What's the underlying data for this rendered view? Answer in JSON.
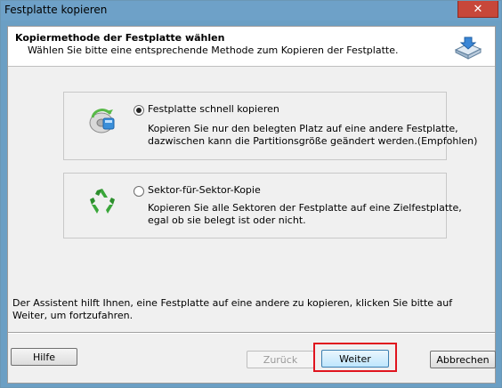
{
  "window": {
    "title": "Festplatte kopieren",
    "close_glyph": "✕"
  },
  "header": {
    "title": "Kopiermethode der Festplatte wählen",
    "subtitle": "Wählen Sie bitte eine entsprechende Methode zum Kopieren der Festplatte.",
    "icon": "disk-copy-icon"
  },
  "options": [
    {
      "label": "Festplatte schnell kopieren",
      "selected": true,
      "description_line1": "Kopieren Sie nur den belegten Platz auf eine andere Festplatte,",
      "description_line2": "dazwischen kann die Partitionsgröße geändert werden.(Empfohlen)",
      "icon": "fast-copy-disk-icon"
    },
    {
      "label": "Sektor-für-Sektor-Kopie",
      "selected": false,
      "description_line1": "Kopieren Sie alle Sektoren der Festplatte auf eine Zielfestplatte,",
      "description_line2": "egal ob sie belegt ist oder nicht.",
      "icon": "recycle-icon"
    }
  ],
  "hint": "Der Assistent hilft Ihnen, eine Festplatte auf eine andere zu kopieren, klicken Sie bitte auf Weiter, um fortzufahren.",
  "buttons": {
    "help": "Hilfe",
    "back": "Zurück",
    "next": "Weiter",
    "cancel": "Abbrechen"
  },
  "colors": {
    "titlebar": "#6ea1c8",
    "close": "#c7473a",
    "highlight": "#e0141e"
  }
}
